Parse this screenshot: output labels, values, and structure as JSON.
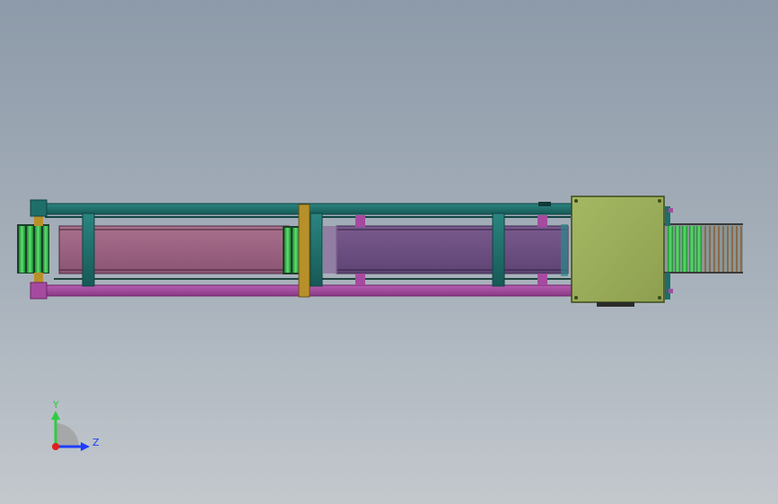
{
  "viewport": {
    "background_top": "#8d9aa9",
    "background_bottom": "#c3c8cd"
  },
  "colors": {
    "frame_teal": "#1f6e69",
    "frame_teal_dark": "#0f4442",
    "rail_purple": "#a64aa0",
    "belt_pink": "#9a5e7e",
    "belt_violet": "#6f4f84",
    "roller_green": "#2fb84a",
    "roller_brown": "#8a6a4a",
    "column_gold": "#b8902a",
    "motor_box": "#9aae5a"
  },
  "triad": {
    "y_axis_label": "Y",
    "z_axis_label": "Z",
    "y_color": "#2ecc40",
    "z_color": "#1f3cff",
    "x_color": "#e0201a"
  }
}
